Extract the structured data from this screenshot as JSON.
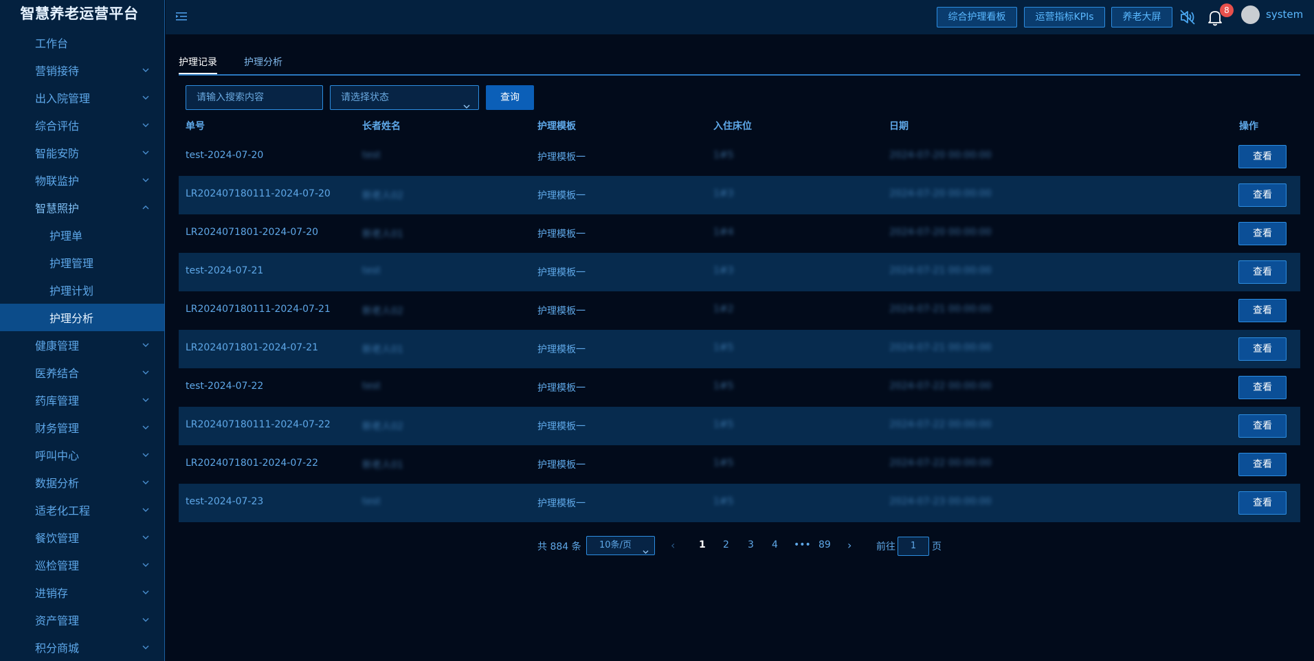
{
  "app": {
    "title": "智慧养老运营平台"
  },
  "sidebar": {
    "items": [
      {
        "label": "工作台",
        "expandable": false
      },
      {
        "label": "营销接待",
        "expandable": true
      },
      {
        "label": "出入院管理",
        "expandable": true
      },
      {
        "label": "综合评估",
        "expandable": true
      },
      {
        "label": "智能安防",
        "expandable": true
      },
      {
        "label": "物联监护",
        "expandable": true
      },
      {
        "label": "智慧照护",
        "expandable": true,
        "open": true
      },
      {
        "label": "健康管理",
        "expandable": true
      },
      {
        "label": "医养结合",
        "expandable": true
      },
      {
        "label": "药库管理",
        "expandable": true
      },
      {
        "label": "财务管理",
        "expandable": true
      },
      {
        "label": "呼叫中心",
        "expandable": true
      },
      {
        "label": "数据分析",
        "expandable": true
      },
      {
        "label": "适老化工程",
        "expandable": true
      },
      {
        "label": "餐饮管理",
        "expandable": true
      },
      {
        "label": "巡检管理",
        "expandable": true
      },
      {
        "label": "进销存",
        "expandable": true
      },
      {
        "label": "资产管理",
        "expandable": true
      },
      {
        "label": "积分商城",
        "expandable": true
      }
    ],
    "submenu": [
      {
        "label": "护理单"
      },
      {
        "label": "护理管理"
      },
      {
        "label": "护理计划"
      },
      {
        "label": "护理分析",
        "active": true
      }
    ]
  },
  "header": {
    "buttons": [
      "综合护理看板",
      "运营指标KPIs",
      "养老大屏"
    ],
    "notification_count": "8",
    "username": "system",
    "icons": [
      "menu-collapse-icon",
      "speaker-muted-icon",
      "bell-icon"
    ]
  },
  "tabs": [
    {
      "label": "护理记录",
      "active": true
    },
    {
      "label": "护理分析",
      "active": false
    }
  ],
  "filters": {
    "search_placeholder": "请输入搜索内容",
    "status_placeholder": "请选择状态",
    "query_label": "查询"
  },
  "table": {
    "columns": [
      "单号",
      "长者姓名",
      "护理模板",
      "入住床位",
      "日期",
      "操作"
    ],
    "rows": [
      {
        "no": "test-2024-07-20",
        "name": "test",
        "template": "护理模板一",
        "bed": "1#5",
        "date": "2024-07-20 00:00:00",
        "action": "查看"
      },
      {
        "no": "LR202407180111-2024-07-20",
        "name": "新老人02",
        "template": "护理模板一",
        "bed": "1#3",
        "date": "2024-07-20 00:00:00",
        "action": "查看"
      },
      {
        "no": "LR2024071801-2024-07-20",
        "name": "新老人01",
        "template": "护理模板一",
        "bed": "1#4",
        "date": "2024-07-20 00:00:00",
        "action": "查看"
      },
      {
        "no": "test-2024-07-21",
        "name": "test",
        "template": "护理模板一",
        "bed": "1#3",
        "date": "2024-07-21 00:00:00",
        "action": "查看"
      },
      {
        "no": "LR202407180111-2024-07-21",
        "name": "新老人02",
        "template": "护理模板一",
        "bed": "1#2",
        "date": "2024-07-21 00:00:00",
        "action": "查看"
      },
      {
        "no": "LR2024071801-2024-07-21",
        "name": "新老人01",
        "template": "护理模板一",
        "bed": "1#5",
        "date": "2024-07-21 00:00:00",
        "action": "查看"
      },
      {
        "no": "test-2024-07-22",
        "name": "test",
        "template": "护理模板一",
        "bed": "1#5",
        "date": "2024-07-22 00:00:00",
        "action": "查看"
      },
      {
        "no": "LR202407180111-2024-07-22",
        "name": "新老人02",
        "template": "护理模板一",
        "bed": "1#5",
        "date": "2024-07-22 00:00:00",
        "action": "查看"
      },
      {
        "no": "LR2024071801-2024-07-22",
        "name": "新老人01",
        "template": "护理模板一",
        "bed": "1#5",
        "date": "2024-07-22 00:00:00",
        "action": "查看"
      },
      {
        "no": "test-2024-07-23",
        "name": "test",
        "template": "护理模板一",
        "bed": "1#5",
        "date": "2024-07-23 00:00:00",
        "action": "查看"
      }
    ]
  },
  "pagination": {
    "total": "共 884 条",
    "page_size": "10条/页",
    "pages": [
      "1",
      "2",
      "3",
      "4",
      "•••",
      "89"
    ],
    "current": "1",
    "goto_label": "前往",
    "goto_value": "1",
    "goto_unit": "页"
  },
  "colors": {
    "background": "#020b1b",
    "sidebar": "#04213f",
    "accent": "#2d8ee2",
    "active_menu": "#0c4c8a",
    "badge": "#e8504c"
  }
}
